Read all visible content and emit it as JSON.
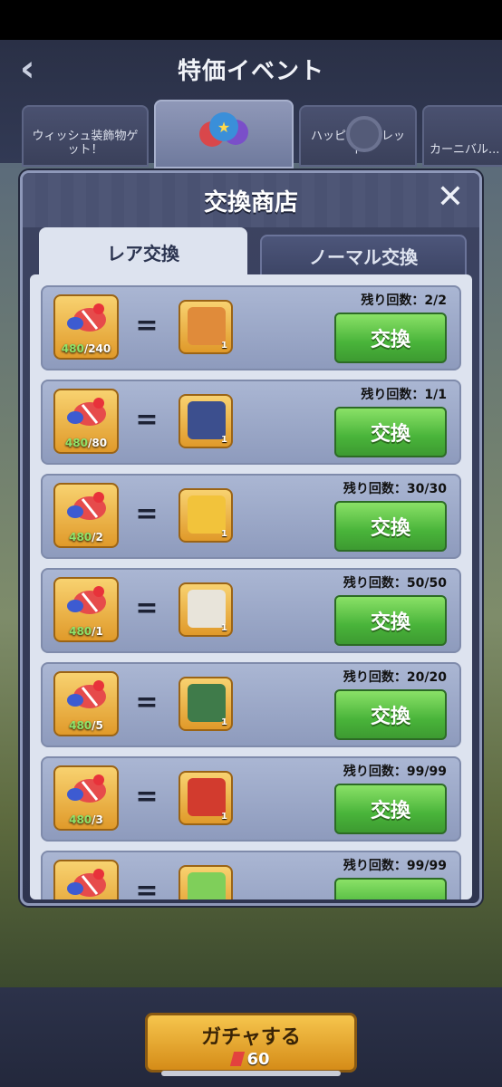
{
  "header": {
    "title": "特価イベント"
  },
  "event_tabs": [
    {
      "label": "ウィッシュ装飾物ゲット！"
    },
    {
      "label": ""
    },
    {
      "label": "ハッピールーレット"
    },
    {
      "label": "カーニバル..."
    }
  ],
  "dialog": {
    "title": "交換商店",
    "tabs": [
      {
        "label": "レア交換"
      },
      {
        "label": "ノーマル交換"
      }
    ]
  },
  "rows": [
    {
      "have": "480",
      "cost": "/240",
      "qty": "1",
      "remain": "残り回数：2/2",
      "button": "交換",
      "reward_icon": "box-icon",
      "color": "#e08b3a"
    },
    {
      "have": "480",
      "cost": "/80",
      "qty": "1",
      "remain": "残り回数：1/1",
      "button": "交換",
      "reward_icon": "cube-icon",
      "color": "#3c4f8e"
    },
    {
      "have": "480",
      "cost": "/2",
      "qty": "1",
      "remain": "残り回数：30/30",
      "button": "交換",
      "reward_icon": "puzzle-icon",
      "color": "#f2c33b"
    },
    {
      "have": "480",
      "cost": "/1",
      "qty": "1",
      "remain": "残り回数：50/50",
      "button": "交換",
      "reward_icon": "papers-icon",
      "color": "#e8e4da"
    },
    {
      "have": "480",
      "cost": "/5",
      "qty": "1",
      "remain": "残り回数：20/20",
      "button": "交換",
      "reward_icon": "chest-icon",
      "color": "#3f7b4a"
    },
    {
      "have": "480",
      "cost": "/3",
      "qty": "1",
      "remain": "残り回数：99/99",
      "button": "交換",
      "reward_icon": "giftbox-icon",
      "color": "#d23b2e"
    },
    {
      "have": "",
      "cost": "",
      "qty": "",
      "remain": "残り回数：99/99",
      "button": "",
      "reward_icon": "ticket-icon",
      "color": "#7fcf5a"
    }
  ],
  "bottom": {
    "gacha_label": "ガチャする",
    "gacha_cost": "60"
  }
}
